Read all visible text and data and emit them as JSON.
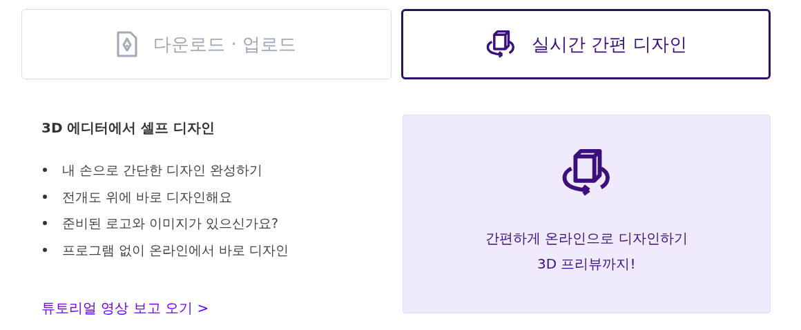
{
  "tabs": [
    {
      "label": "다운로드 · 업로드",
      "kind": "file",
      "selected": false
    },
    {
      "label": "실시간 간편 디자인",
      "kind": "cube",
      "selected": true
    }
  ],
  "content": {
    "title": "3D 에디터에서 셀프 디자인",
    "bullets": [
      "내 손으로 간단한 디자인 완성하기",
      "전개도 위에 바로 디자인해요",
      "준비된 로고와 이미지가 있으신가요?",
      "프로그램 없이 온라인에서 바로 디자인"
    ],
    "link": "튜토리얼 영상 보고 오기 >"
  },
  "panel": {
    "lines": [
      "간편하게 온라인으로 디자인하기",
      "3D 프리뷰까지!"
    ]
  }
}
